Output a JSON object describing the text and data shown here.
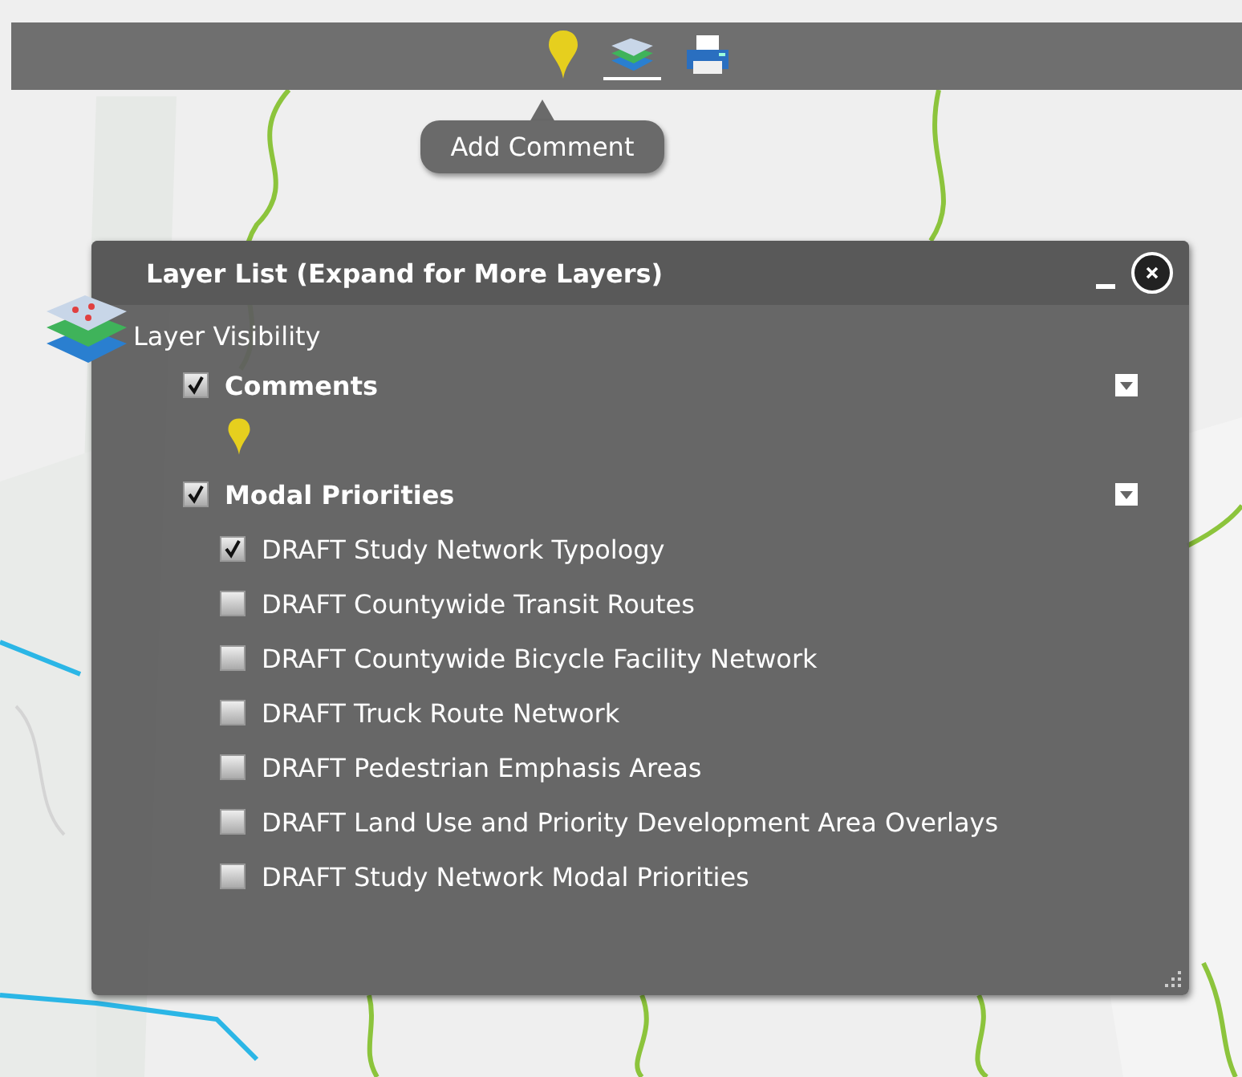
{
  "toolbar": {
    "tools": [
      {
        "kind": "pin",
        "selected": false
      },
      {
        "kind": "layers",
        "selected": true
      },
      {
        "kind": "print",
        "selected": false
      }
    ],
    "tooltip": "Add Comment"
  },
  "panel": {
    "title": "Layer List (Expand for More Layers)",
    "visibility_label": "Layer Visibility",
    "layers": [
      {
        "label": "Comments",
        "checked": true,
        "legend": {
          "kind": "pin"
        }
      },
      {
        "label": "Modal Priorities",
        "checked": true,
        "children": [
          {
            "label": "DRAFT Study Network Typology",
            "checked": true
          },
          {
            "label": "DRAFT Countywide Transit Routes",
            "checked": false
          },
          {
            "label": "DRAFT Countywide Bicycle Facility Network",
            "checked": false
          },
          {
            "label": "DRAFT Truck Route Network",
            "checked": false
          },
          {
            "label": "DRAFT Pedestrian Emphasis Areas",
            "checked": false
          },
          {
            "label": "DRAFT Land Use and Priority Development Area Overlays",
            "checked": false
          },
          {
            "label": "DRAFT Study Network Modal Priorities",
            "checked": false
          }
        ]
      }
    ]
  }
}
